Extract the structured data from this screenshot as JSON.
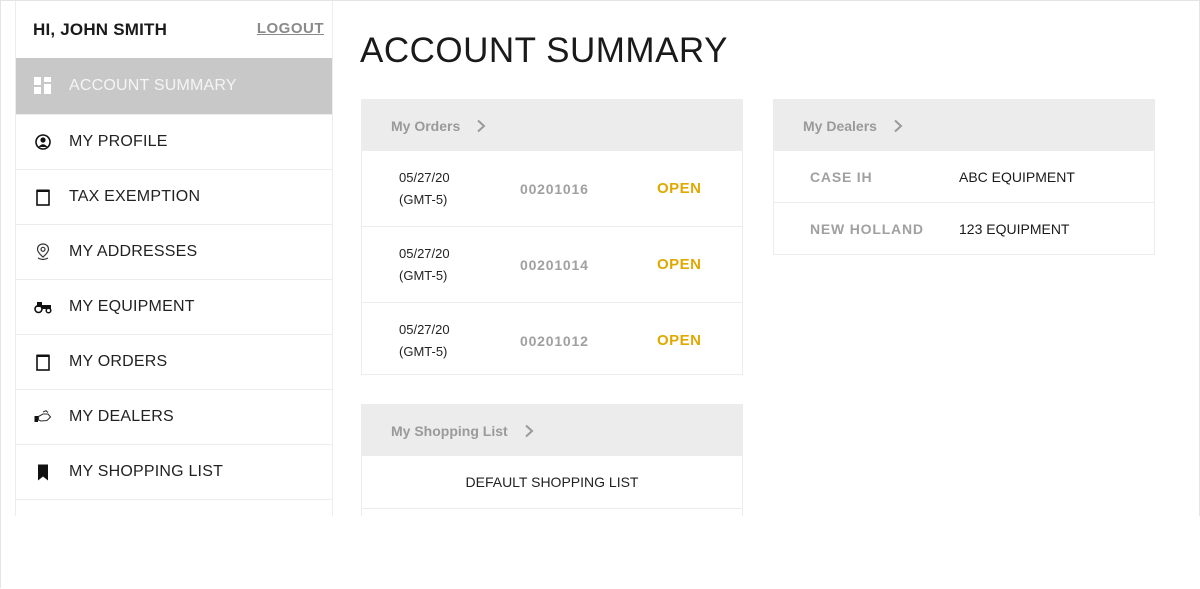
{
  "sidebar": {
    "greeting": "HI, JOHN SMITH",
    "logout_label": "LOGOUT",
    "items": [
      {
        "label": "ACCOUNT SUMMARY",
        "icon": "dashboard-icon",
        "active": true
      },
      {
        "label": "MY PROFILE",
        "icon": "user-circle-icon"
      },
      {
        "label": "TAX EXEMPTION",
        "icon": "document-icon"
      },
      {
        "label": "MY ADDRESSES",
        "icon": "map-pin-icon"
      },
      {
        "label": "MY EQUIPMENT",
        "icon": "tractor-icon"
      },
      {
        "label": "MY ORDERS",
        "icon": "document-icon"
      },
      {
        "label": "MY DEALERS",
        "icon": "handshake-icon"
      },
      {
        "label": "MY SHOPPING LIST",
        "icon": "bookmark-icon"
      }
    ]
  },
  "main": {
    "title": "ACCOUNT SUMMARY",
    "orders": {
      "title": "My Orders",
      "rows": [
        {
          "date": "05/27/20",
          "tz": "(GMT-5)",
          "number": "00201016",
          "status": "OPEN"
        },
        {
          "date": "05/27/20",
          "tz": "(GMT-5)",
          "number": "00201014",
          "status": "OPEN"
        },
        {
          "date": "05/27/20",
          "tz": "(GMT-5)",
          "number": "00201012",
          "status": "OPEN"
        }
      ]
    },
    "shopping_list": {
      "title": "My Shopping List",
      "rows": [
        {
          "name": "DEFAULT SHOPPING LIST"
        }
      ]
    },
    "dealers": {
      "title": "My Dealers",
      "rows": [
        {
          "brand": "CASE IH",
          "dealer": "ABC EQUIPMENT"
        },
        {
          "brand": "NEW HOLLAND",
          "dealer": "123 EQUIPMENT"
        }
      ]
    }
  },
  "colors": {
    "status_open": "#e0a800",
    "active_nav_bg": "#c8c8c8",
    "card_header_bg": "#ececec"
  }
}
